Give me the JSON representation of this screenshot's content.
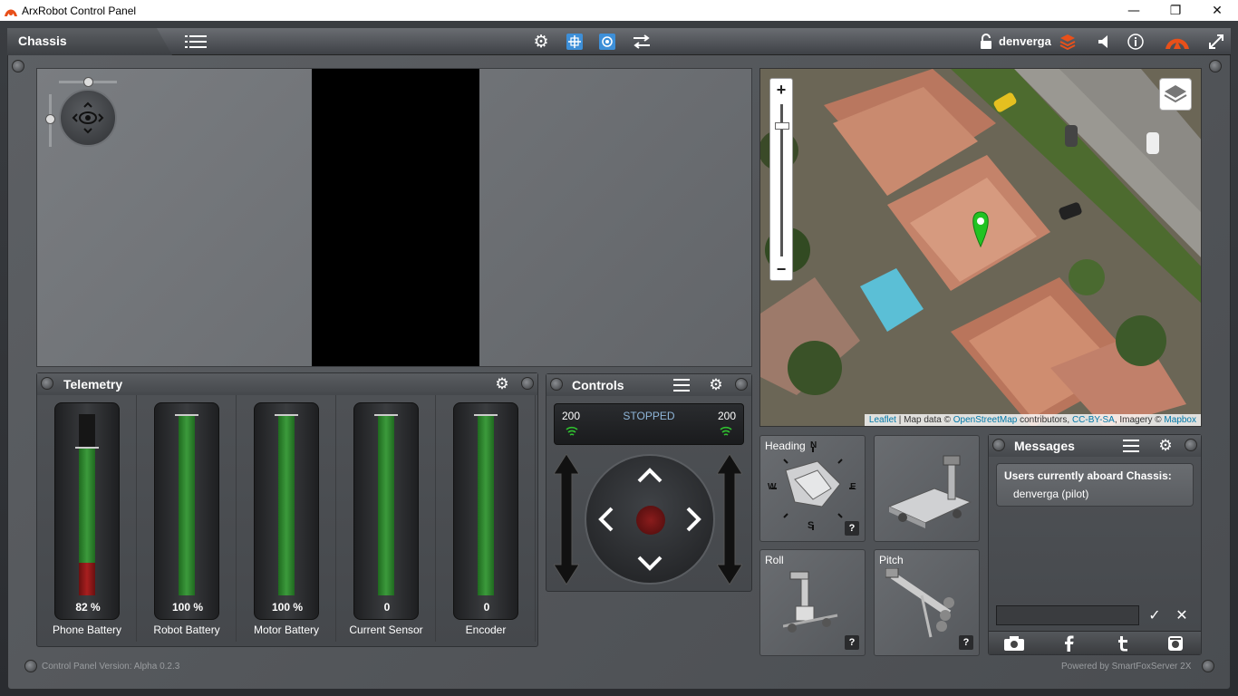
{
  "window": {
    "title": "ArxRobot Control Panel",
    "minimize": "—",
    "maximize": "❐",
    "close": "✕"
  },
  "topbar": {
    "tab": "Chassis",
    "username": "denverga",
    "icons": [
      "list-icon",
      "gear-icon",
      "grid-icon",
      "target-icon",
      "swap-icon",
      "lock-icon",
      "stack-icon",
      "speaker-icon",
      "info-icon",
      "logo-icon",
      "fullscreen-icon"
    ]
  },
  "map": {
    "zoom_in": "+",
    "zoom_out": "−",
    "attribution": {
      "leaflet": "Leaflet",
      "sep1": " | Map data © ",
      "osm": "OpenStreetMap",
      "contrib": " contributors, ",
      "license": "CC-BY-SA",
      "imagery": ", Imagery © ",
      "mapbox": "Mapbox"
    }
  },
  "telemetry": {
    "title": "Telemetry",
    "gauges": [
      {
        "label": "Phone Battery",
        "value": "82 %",
        "level": 0.82,
        "red_level": 0.18
      },
      {
        "label": "Robot Battery",
        "value": "100 %",
        "level": 1.0,
        "red_level": 0
      },
      {
        "label": "Motor Battery",
        "value": "100 %",
        "level": 1.0,
        "red_level": 0
      },
      {
        "label": "Current Sensor",
        "value": "0",
        "level": 1.0,
        "red_level": 0
      },
      {
        "label": "Encoder",
        "value": "0",
        "level": 1.0,
        "red_level": 0
      }
    ]
  },
  "controls": {
    "title": "Controls",
    "left_value": "200",
    "right_value": "200",
    "status": "STOPPED"
  },
  "instruments": {
    "heading": {
      "label": "Heading",
      "n": "N",
      "s": "S",
      "e": "E",
      "w": "W",
      "help": "?"
    },
    "roll": {
      "label": "Roll",
      "help": "?"
    },
    "pitch": {
      "label": "Pitch",
      "help": "?"
    }
  },
  "messages": {
    "title": "Messages",
    "users_title": "Users currently aboard Chassis:",
    "users": [
      "denverga (pilot)"
    ],
    "input_placeholder": "",
    "send": "✓",
    "clear": "✕"
  },
  "footer": {
    "version": "Control Panel Version: Alpha 0.2.3",
    "powered": "Powered by SmartFoxServer 2X"
  },
  "colors": {
    "accent": "#e8501a",
    "gauge_green": "#3c9a3c",
    "gauge_red": "#a81f1f",
    "status_blue": "#8fb6d9",
    "map_marker": "#22c322"
  }
}
